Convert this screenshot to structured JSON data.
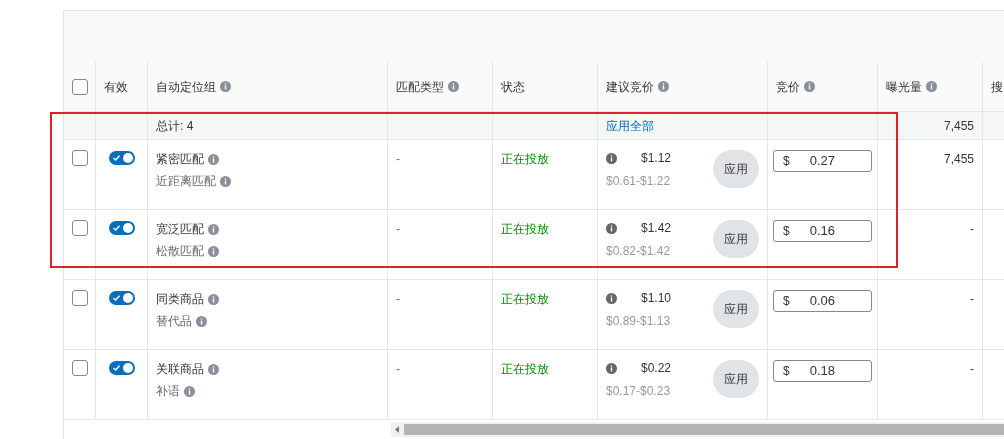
{
  "header": {
    "select_all_checked": false,
    "columns": [
      {
        "label": "有效",
        "info": false
      },
      {
        "label": "自动定位组",
        "info": true
      },
      {
        "label": "匹配类型",
        "info": true
      },
      {
        "label": "状态",
        "info": false
      },
      {
        "label": "建议竞价",
        "info": true
      },
      {
        "label": "竞价",
        "info": true
      },
      {
        "label": "曝光量",
        "info": true
      },
      {
        "label": "搜",
        "info": false
      }
    ]
  },
  "total_row": {
    "label": "总计: 4",
    "apply_all": "应用全部",
    "impressions": "7,455"
  },
  "rows": [
    {
      "checked": false,
      "enabled": true,
      "name": "紧密匹配",
      "subname": "近距离匹配",
      "match_type": "-",
      "status": "正在投放",
      "suggested_bid": "$1.12",
      "bid_range": "$0.61-$1.22",
      "apply": "应用",
      "currency": "$",
      "bid": "0.27",
      "impressions": "7,455"
    },
    {
      "checked": false,
      "enabled": true,
      "name": "宽泛匹配",
      "subname": "松散匹配",
      "match_type": "-",
      "status": "正在投放",
      "suggested_bid": "$1.42",
      "bid_range": "$0.82-$1.42",
      "apply": "应用",
      "currency": "$",
      "bid": "0.16",
      "impressions": "-"
    },
    {
      "checked": false,
      "enabled": true,
      "name": "同类商品",
      "subname": "替代品",
      "match_type": "-",
      "status": "正在投放",
      "suggested_bid": "$1.10",
      "bid_range": "$0.89-$1.13",
      "apply": "应用",
      "currency": "$",
      "bid": "0.06",
      "impressions": "-"
    },
    {
      "checked": false,
      "enabled": true,
      "name": "关联商品",
      "subname": "补语",
      "match_type": "-",
      "status": "正在投放",
      "suggested_bid": "$0.22",
      "bid_range": "$0.17-$0.23",
      "apply": "应用",
      "currency": "$",
      "bid": "0.18",
      "impressions": "-"
    }
  ]
}
